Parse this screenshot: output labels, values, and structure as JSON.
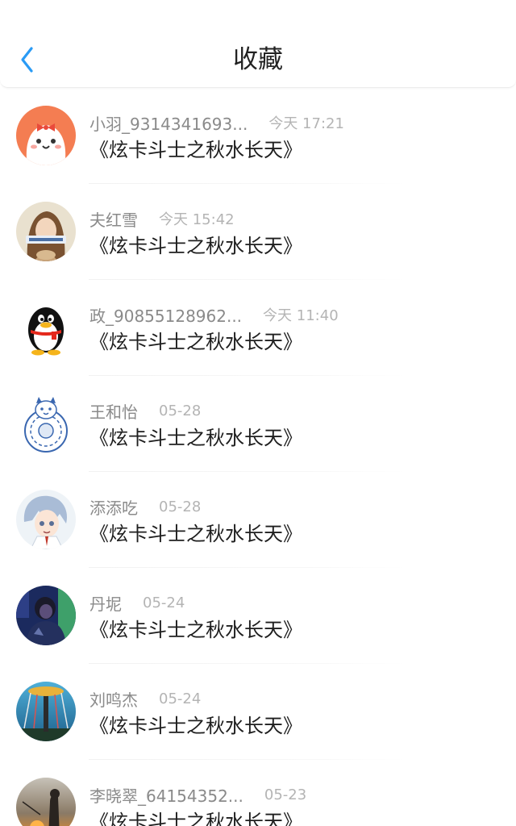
{
  "header": {
    "title": "收藏",
    "back_icon": "chevron-left-icon",
    "accent_color": "#2a9bf5"
  },
  "favorites": [
    {
      "user": "小羽_9314341693...",
      "time": "今天 17:21",
      "title": "《炫卡斗士之秋水长天》",
      "avatar": "cartoon-ghost-avatar"
    },
    {
      "user": "夫红雪",
      "time": "今天 15:42",
      "title": "《炫卡斗士之秋水长天》",
      "avatar": "girl-photo-avatar"
    },
    {
      "user": "政_90855128962...",
      "time": "今天 11:40",
      "title": "《炫卡斗士之秋水长天》",
      "avatar": "penguin-avatar"
    },
    {
      "user": "王和怡",
      "time": "05-28",
      "title": "《炫卡斗士之秋水长天》",
      "avatar": "porcelain-tiger-avatar"
    },
    {
      "user": "添添吃",
      "time": "05-28",
      "title": "《炫卡斗士之秋水长天》",
      "avatar": "anime-boy-avatar"
    },
    {
      "user": "丹坭",
      "time": "05-24",
      "title": "《炫卡斗士之秋水长天》",
      "avatar": "night-portrait-avatar"
    },
    {
      "user": "刘鸣杰",
      "time": "05-24",
      "title": "《炫卡斗士之秋水长天》",
      "avatar": "fair-ride-avatar"
    },
    {
      "user": "李晓翠_64154352...",
      "time": "05-23",
      "title": "《炫卡斗士之秋水长天》",
      "avatar": "sunset-figure-avatar"
    }
  ]
}
